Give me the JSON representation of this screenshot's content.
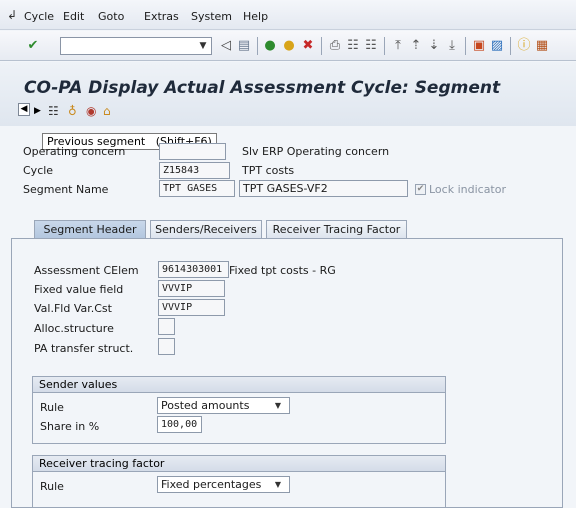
{
  "menu": {
    "items": [
      {
        "label": "Cycle"
      },
      {
        "label": "Edit"
      },
      {
        "label": "Goto"
      },
      {
        "label": "Extras"
      },
      {
        "label": "System"
      },
      {
        "label": "Help"
      }
    ]
  },
  "title": "CO-PA Display Actual Assessment Cycle: Segment",
  "tooltip": "Previous segment   (Shift+F6)",
  "header": {
    "operating_concern_label": "Operating concern",
    "operating_concern_value": "",
    "operating_concern_desc": "Slv ERP Operating concern",
    "cycle_label": "Cycle",
    "cycle_value": "Z15843",
    "cycle_desc": "TPT costs",
    "segment_label": "Segment Name",
    "segment_value": "TPT GASES",
    "segment_desc": "TPT GASES-VF2",
    "lock_label": "Lock indicator",
    "lock_checked": true
  },
  "tabs": [
    {
      "label": "Segment Header",
      "active": true
    },
    {
      "label": "Senders/Receivers",
      "active": false
    },
    {
      "label": "Receiver Tracing Factor",
      "active": false
    }
  ],
  "segment_header": {
    "assessment_label": "Assessment CElem",
    "assessment_value": "9614303001",
    "assessment_desc": "Fixed tpt costs - RG",
    "fixed_value_label": "Fixed value field",
    "fixed_value_value": "VVVIP",
    "valfld_label": "Val.Fld Var.Cst",
    "valfld_value": "VVVIP",
    "alloc_label": "Alloc.structure",
    "alloc_value": "",
    "pa_transfer_label": "PA transfer struct.",
    "pa_transfer_value": ""
  },
  "sender_values": {
    "title": "Sender values",
    "rule_label": "Rule",
    "rule_value": "Posted amounts",
    "share_label": "Share in %",
    "share_value": "100,00"
  },
  "receiver_tracing": {
    "title": "Receiver tracing factor",
    "rule_label": "Rule",
    "rule_value": "Fixed percentages"
  }
}
